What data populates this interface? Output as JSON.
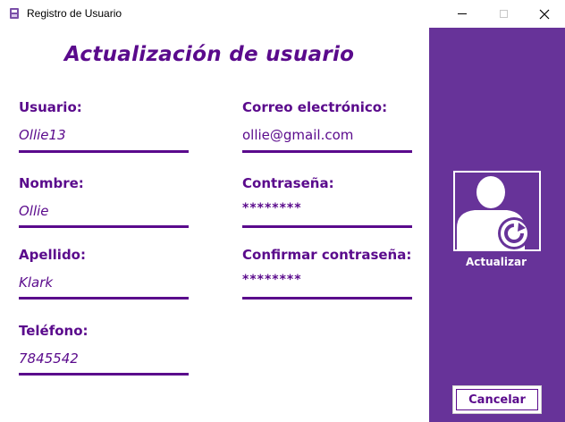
{
  "window": {
    "title": "Registro de Usuario",
    "icon": "form-icon",
    "controls": [
      "minimize",
      "maximize",
      "close"
    ]
  },
  "form": {
    "heading": "Actualización de usuario",
    "fields": [
      {
        "label": "Usuario:",
        "value": "Ollie13"
      },
      {
        "label": "Nombre:",
        "value": "Ollie"
      },
      {
        "label": "Apellido:",
        "value": "Klark"
      },
      {
        "label": "Teléfono:",
        "value": "7845542"
      },
      {
        "label": "Correo electrónico:",
        "value": "ollie@gmail.com"
      },
      {
        "label": "Contraseña:",
        "value": "********"
      },
      {
        "label": "Confirmar contraseña:",
        "value": "********"
      }
    ]
  },
  "sidebar": {
    "update_label": "Actualizar",
    "update_icon": "user-refresh-icon",
    "cancel_label": "Cancelar"
  },
  "colors": {
    "primary": "#5a0a8c",
    "sidebar": "#673399",
    "background": "#ffffff"
  }
}
